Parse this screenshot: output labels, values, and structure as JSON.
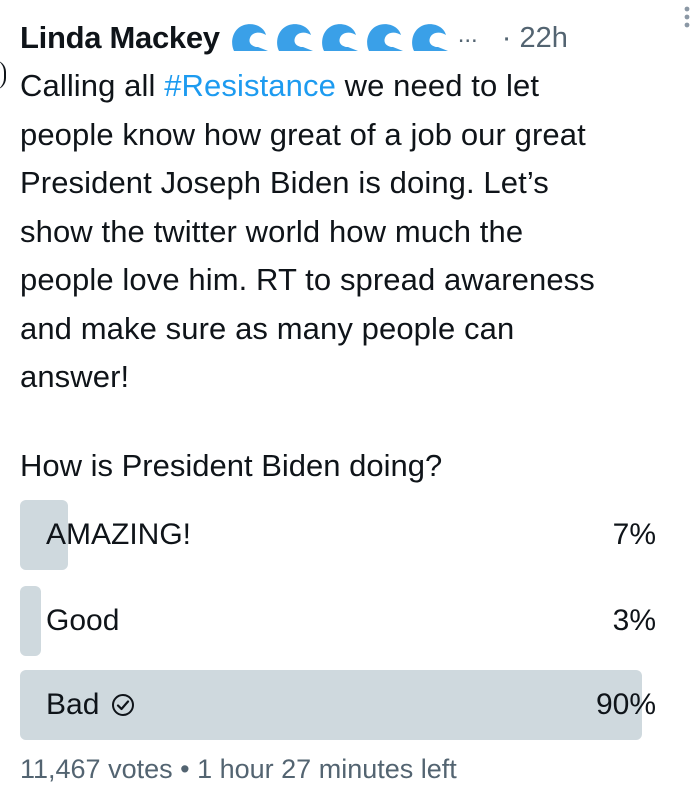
{
  "tweet": {
    "author_name": "Linda Mackey",
    "name_badges": [
      "wave-icon",
      "wave-icon",
      "wave-icon",
      "wave-icon",
      "wave-icon"
    ],
    "name_overflow": "...",
    "timestamp_separator": "·",
    "timestamp": "22h",
    "text_prefix": "Calling all ",
    "hashtag": "#Resistance",
    "text_rest": " we need to let\npeople know how great of a job our great\nPresident Joseph Biden is doing. Let’s\nshow the twitter world how much the\npeople love him. RT to spread awareness\nand make sure as many people can\nanswer!",
    "hashtag_color": "#1d9bf0"
  },
  "poll": {
    "question": "How is President Biden doing?",
    "options": [
      {
        "label": "AMAZING!",
        "percent_text": "7%",
        "percent": 7,
        "winner": false
      },
      {
        "label": "Good",
        "percent_text": "3%",
        "percent": 3,
        "winner": false
      },
      {
        "label": "Bad",
        "percent_text": "90%",
        "percent": 90,
        "winner": true
      }
    ],
    "fill_color": "#cfd9de",
    "votes": "11,467 votes",
    "meta_separator": "•",
    "time_left": "1 hour 27 minutes left"
  },
  "colors": {
    "text": "#0f1419",
    "secondary": "#536471",
    "accent": "#1d9bf0",
    "wave": "#3aa0e8"
  }
}
